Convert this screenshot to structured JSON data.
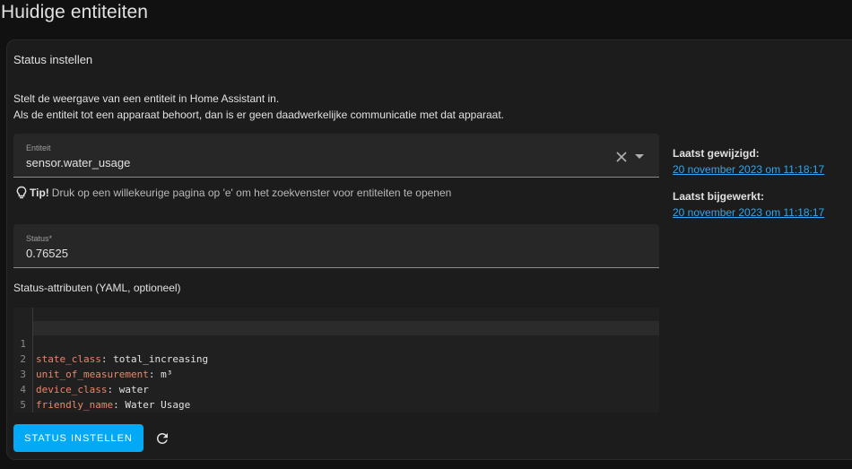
{
  "page": {
    "title": "Huidige entiteiten"
  },
  "card": {
    "title": "Status instellen",
    "description_line1": "Stelt de weergave van een entiteit in Home Assistant in.",
    "description_line2": "Als de entiteit tot een apparaat behoort, dan is er geen daadwerkelijke communicatie met dat apparaat."
  },
  "entity_field": {
    "label": "Entiteit",
    "value": "sensor.water_usage",
    "icons": [
      "close-icon",
      "dropdown-arrow-icon"
    ]
  },
  "tip": {
    "label": "Tip!",
    "text": "Druk op een willekeurige pagina op 'e' om het zoekvenster voor entiteiten te openen",
    "icon": "lightbulb-icon"
  },
  "state_field": {
    "label": "Status*",
    "value": "0.76525"
  },
  "attributes": {
    "label": "Status-attributen (YAML, optioneel)",
    "lines": [
      {
        "num": "1",
        "key": "state_class",
        "sep": ": ",
        "value": "total_increasing"
      },
      {
        "num": "2",
        "key": "unit_of_measurement",
        "sep": ": ",
        "value": "m³"
      },
      {
        "num": "3",
        "key": "device_class",
        "sep": ": ",
        "value": "water"
      },
      {
        "num": "4",
        "key": "friendly_name",
        "sep": ": ",
        "value": "Water Usage"
      },
      {
        "num": "5",
        "key": "",
        "sep": "",
        "value": ""
      }
    ]
  },
  "sidebar": {
    "last_changed_label": "Laatst gewijzigd:",
    "last_changed_value": "20 november 2023 om 11:18:17",
    "last_updated_label": "Laatst bijgewerkt:",
    "last_updated_value": "20 november 2023 om 11:18:17"
  },
  "actions": {
    "set_state_label": "STATUS INSTELLEN",
    "refresh_icon": "refresh-icon"
  },
  "colors": {
    "accent": "#03a9f4",
    "link": "#2fa8ef",
    "yaml_key": "#e8876a",
    "background": "#111111",
    "card": "#1c1c1c"
  }
}
